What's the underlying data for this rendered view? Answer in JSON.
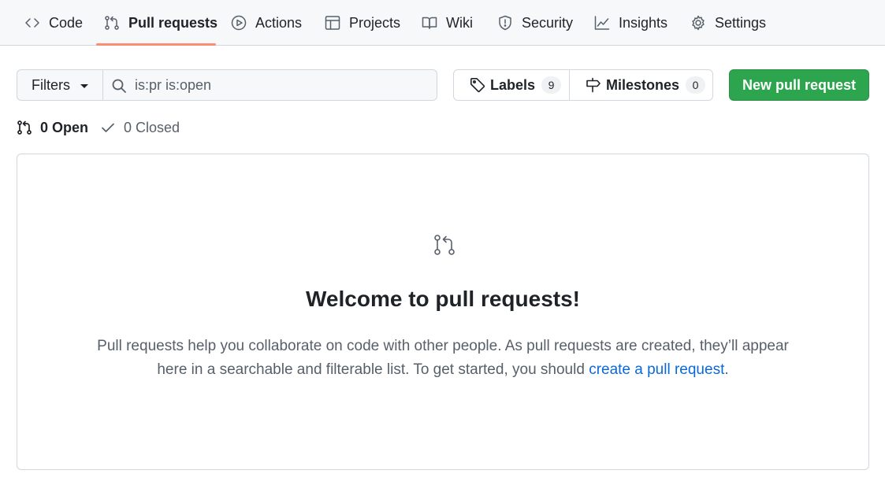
{
  "nav": {
    "tabs": [
      {
        "label": "Code",
        "icon": "code-icon"
      },
      {
        "label": "Pull requests",
        "icon": "git-pull-request-icon",
        "active": true
      },
      {
        "label": "Actions",
        "icon": "play-icon"
      },
      {
        "label": "Projects",
        "icon": "table-icon"
      },
      {
        "label": "Wiki",
        "icon": "book-icon"
      },
      {
        "label": "Security",
        "icon": "shield-icon"
      },
      {
        "label": "Insights",
        "icon": "graph-icon"
      },
      {
        "label": "Settings",
        "icon": "gear-icon"
      }
    ]
  },
  "toolbar": {
    "filters_label": "Filters",
    "search_value": "is:pr is:open",
    "labels_label": "Labels",
    "labels_count": "9",
    "milestones_label": "Milestones",
    "milestones_count": "0",
    "new_pr_label": "New pull request"
  },
  "states": {
    "open_label": "0 Open",
    "closed_label": "0 Closed"
  },
  "blankslate": {
    "title": "Welcome to pull requests!",
    "description": "Pull requests help you collaborate on code with other people. As pull requests are created, they’ll appear here in a searchable and filterable list. To get started, you should",
    "link_text": "create a pull request",
    "trailing": "."
  },
  "colors": {
    "accent_underline": "#fd8c73",
    "primary_button": "#2da44e",
    "link": "#0969da"
  }
}
